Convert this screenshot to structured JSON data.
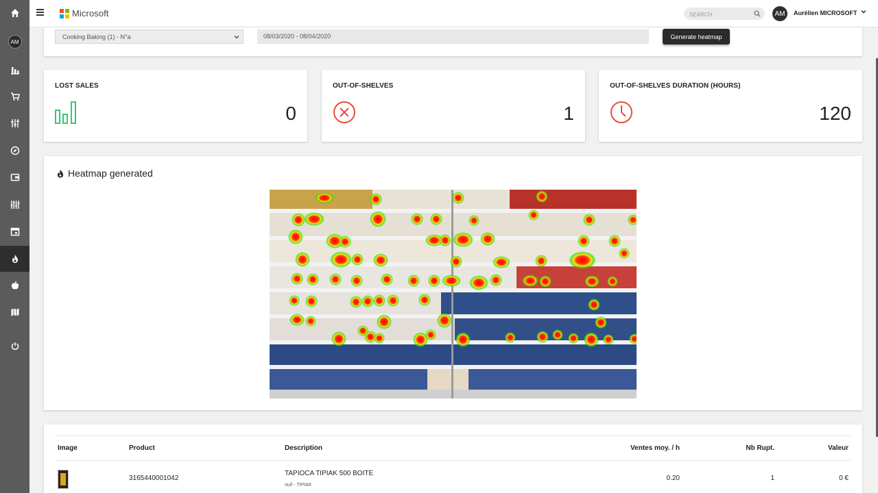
{
  "sidebar": {
    "avatar_initials": "AM",
    "items": [
      {
        "icon": "home-icon"
      },
      {
        "icon": "avatar"
      },
      {
        "icon": "bar-chart-icon"
      },
      {
        "icon": "cart-icon"
      },
      {
        "icon": "sliders-icon"
      },
      {
        "icon": "compass-icon"
      },
      {
        "icon": "wallet-icon"
      },
      {
        "icon": "equalizer-icon"
      },
      {
        "icon": "calendar-icon"
      },
      {
        "icon": "flame-icon",
        "active": true
      },
      {
        "icon": "apple-icon"
      },
      {
        "icon": "map-icon"
      },
      {
        "icon": "power-icon"
      }
    ]
  },
  "topbar": {
    "brand": "Microsoft",
    "search_placeholder": "SEARCH",
    "user_initials": "AM",
    "user_name": "Aurélien MICROSOFT"
  },
  "filters": {
    "category": "Cooking Baking (1) - N°a",
    "date_range": "08/03/2020 - 08/04/2020",
    "generate_label": "Generate heatmap"
  },
  "stats": [
    {
      "title": "LOST SALES",
      "value": "0",
      "icon": "bar-chart-icon",
      "color": "#2ecc71"
    },
    {
      "title": "OUT-OF-SHELVES",
      "value": "1",
      "icon": "x-circle-icon",
      "color": "#e74c3c"
    },
    {
      "title": "OUT-OF-SHELVES DURATION (HOURS)",
      "value": "120",
      "icon": "clock-icon",
      "color": "#e74c3c"
    }
  ],
  "heatmap": {
    "title": "Heatmap generated"
  },
  "table": {
    "headers": [
      "Image",
      "Product",
      "Description",
      "Ventes moy. / h",
      "Nb Rupt.",
      "Valeur"
    ],
    "rows": [
      {
        "product": "3165440001042",
        "description": "TAPIOCA TIPIAK 500 BOITE",
        "sub": "null - TIPIAK",
        "ventes": "0.20",
        "ruptures": "1",
        "valeur": "0 €"
      }
    ]
  }
}
